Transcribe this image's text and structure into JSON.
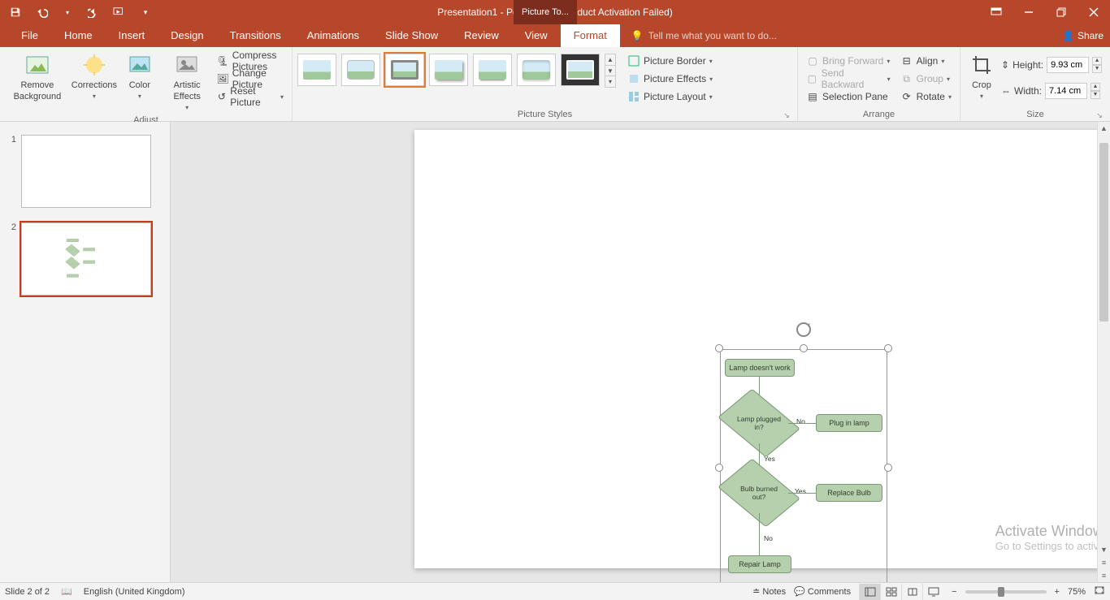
{
  "app": {
    "title": "Presentation1 - PowerPoint (Product Activation Failed)",
    "picture_tools_label": "Picture To..."
  },
  "tabs": {
    "file": "File",
    "home": "Home",
    "insert": "Insert",
    "design": "Design",
    "transitions": "Transitions",
    "animations": "Animations",
    "slideshow": "Slide Show",
    "review": "Review",
    "view": "View",
    "format": "Format",
    "tellme_placeholder": "Tell me what you want to do...",
    "share": "Share"
  },
  "ribbon": {
    "adjust": {
      "label": "Adjust",
      "remove_bg": "Remove Background",
      "corrections": "Corrections",
      "color": "Color",
      "artistic": "Artistic Effects",
      "compress": "Compress Pictures",
      "change": "Change Picture",
      "reset": "Reset Picture"
    },
    "picture_styles": {
      "label": "Picture Styles",
      "border": "Picture Border",
      "effects": "Picture Effects",
      "layout": "Picture Layout"
    },
    "arrange": {
      "label": "Arrange",
      "bring_forward": "Bring Forward",
      "send_backward": "Send Backward",
      "selection_pane": "Selection Pane",
      "align": "Align",
      "group": "Group",
      "rotate": "Rotate"
    },
    "crop": {
      "label": "Crop"
    },
    "size": {
      "label": "Size",
      "height_label": "Height:",
      "width_label": "Width:",
      "height_value": "9.93 cm",
      "width_value": "7.14 cm"
    }
  },
  "slides": {
    "num1": "1",
    "num2": "2"
  },
  "chart_data": {
    "type": "flowchart",
    "nodes": [
      {
        "id": "start",
        "shape": "rect",
        "text": "Lamp doesn't work"
      },
      {
        "id": "d1",
        "shape": "diamond",
        "text": "Lamp plugged in?"
      },
      {
        "id": "a1",
        "shape": "rect",
        "text": "Plug in lamp"
      },
      {
        "id": "d2",
        "shape": "diamond",
        "text": "Bulb burned out?"
      },
      {
        "id": "a2",
        "shape": "rect",
        "text": "Replace Bulb"
      },
      {
        "id": "end",
        "shape": "rect",
        "text": "Repair Lamp"
      }
    ],
    "edges": [
      {
        "from": "start",
        "to": "d1",
        "label": ""
      },
      {
        "from": "d1",
        "to": "a1",
        "label": "No"
      },
      {
        "from": "d1",
        "to": "d2",
        "label": "Yes"
      },
      {
        "from": "d2",
        "to": "a2",
        "label": "Yes"
      },
      {
        "from": "d2",
        "to": "end",
        "label": "No"
      }
    ]
  },
  "flowchart": {
    "start": "Lamp doesn't work",
    "d1": "Lamp plugged in?",
    "a1": "Plug in lamp",
    "d2": "Bulb burned out?",
    "a2": "Replace Bulb",
    "end": "Repair Lamp",
    "no": "No",
    "yes": "Yes"
  },
  "watermark": {
    "title": "Activate Windows",
    "sub": "Go to Settings to activate Windows."
  },
  "status": {
    "slide": "Slide 2 of 2",
    "lang": "English (United Kingdom)",
    "notes": "Notes",
    "comments": "Comments",
    "zoom": "75%"
  }
}
